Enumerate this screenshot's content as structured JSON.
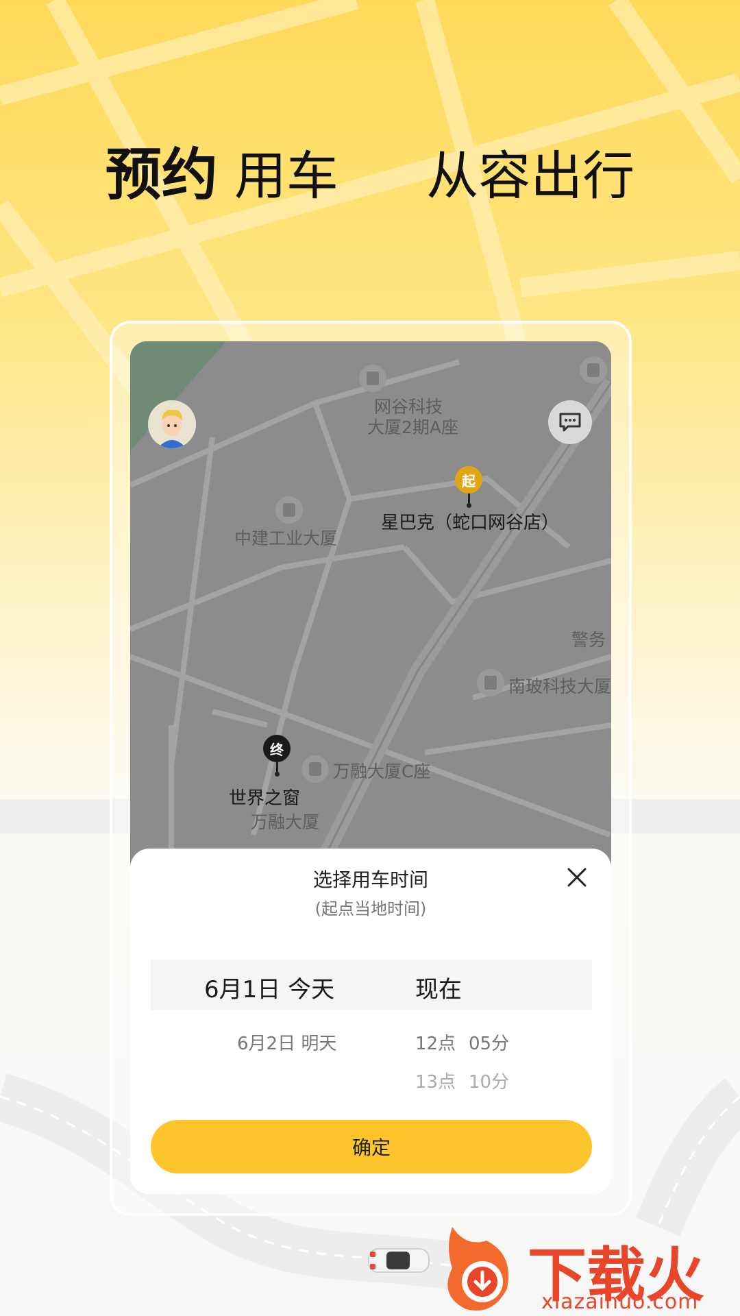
{
  "headline": {
    "strong": "预约",
    "rest": "用车",
    "slogan": "从容出行"
  },
  "map": {
    "labels": {
      "building_a": "网谷科技",
      "building_a2": "大厦2期A座",
      "building_b": "中建工业大厦",
      "start_place": "星巴克（蛇口网谷店）",
      "police": "警务",
      "building_c": "南玻科技大厦",
      "building_d": "万融大厦C座",
      "end_place": "世界之窗",
      "building_e": "万融大厦"
    },
    "start_pin": "起",
    "end_pin": "终"
  },
  "sheet": {
    "title": "选择用车时间",
    "subtitle": "(起点当地时间)",
    "date_selected": "6月1日 今天",
    "time_selected": "现在",
    "date_next": "6月2日  明天",
    "hour_1": "12点",
    "minute_1": "05分",
    "hour_2": "13点",
    "minute_2": "10分",
    "confirm_label": "确定"
  },
  "watermark": {
    "brand": "下载火",
    "url": "xiazaihuo.com"
  },
  "colors": {
    "accent": "#FBC52B",
    "start_pin": "#E2A614",
    "end_pin": "#1A1A1A",
    "watermark": "#E8462A"
  }
}
